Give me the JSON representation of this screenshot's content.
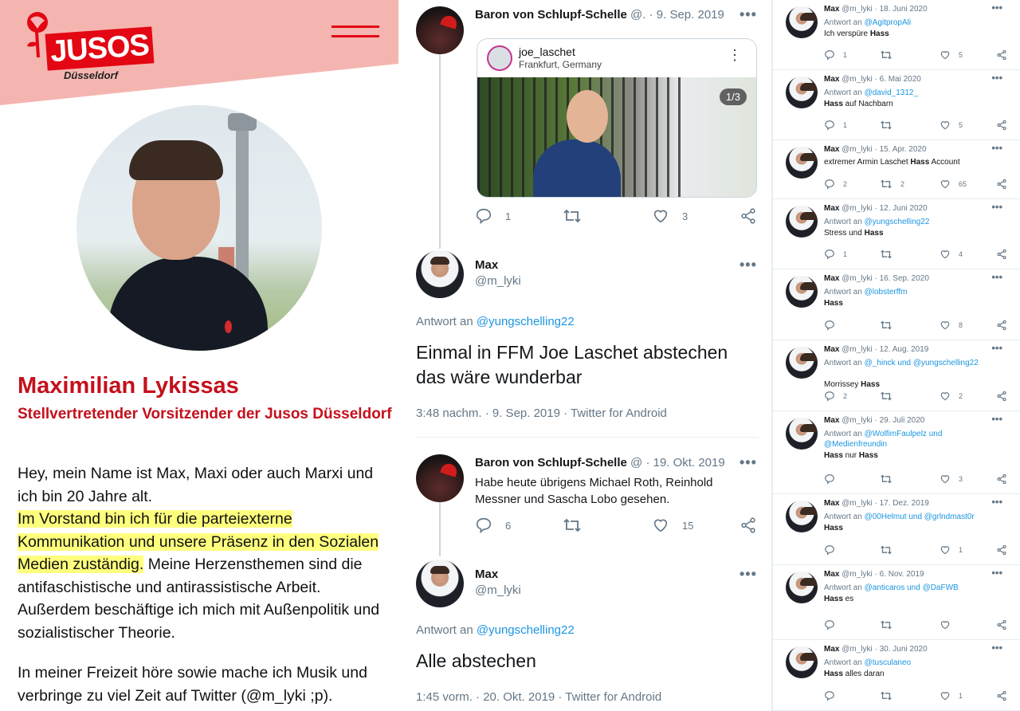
{
  "left_panel": {
    "logo_text": "JUSOS",
    "logo_city": "Düsseldorf",
    "name": "Maximilian Lykissas",
    "role": "Stellvertretender Vorsitzender der Jusos Düsseldorf",
    "bio_intro": "Hey, mein Name ist Max, Maxi oder auch Marxi und ich bin 20 Jahre alt.",
    "bio_highlight": "Im Vorstand bin ich für die parteiexterne Kommunikation und unsere Präsenz in den Sozialen Medien zuständig.",
    "bio_rest": " Meine Herzensthemen sind die antifaschistische und antirassistische Arbeit. Außerdem beschäftige ich mich mit Außenpolitik und sozialistischer Theorie.",
    "bio_free_time": "In meiner Freizeit höre sowie mache ich Musik und verbringe zu viel Zeit auf Twitter (@m_lyki ;p)."
  },
  "middle_panel": {
    "tweet1": {
      "name": "Baron von Schlupf-Schelle",
      "handle_date": "@. · 9. Sep. 2019",
      "instagram": {
        "user": "joe_laschet",
        "location": "Frankfurt, Germany",
        "counter": "1/3"
      },
      "replies": "1",
      "likes": "3"
    },
    "tweet2": {
      "name": "Max",
      "handle": "@m_lyki",
      "reply_prefix": "Antwort an",
      "reply_to": "@yungschelling22",
      "text": "Einmal in FFM Joe Laschet abstechen das wäre wunderbar",
      "timestamp": "3:48 nachm. · 9. Sep. 2019 · Twitter for Android"
    },
    "tweet3": {
      "name": "Baron von Schlupf-Schelle",
      "handle_date": "@ · 19. Okt. 2019",
      "text": "Habe heute übrigens Michael Roth, Reinhold Messner und Sascha Lobo gesehen.",
      "replies": "6",
      "likes": "15"
    },
    "tweet4": {
      "name": "Max",
      "handle": "@m_lyki",
      "reply_prefix": "Antwort an",
      "reply_to": "@yungschelling22",
      "text": "Alle abstechen",
      "timestamp": "1:45 vorm. · 20. Okt. 2019 · Twitter for Android"
    }
  },
  "right_panel": {
    "tweets": [
      {
        "name": "Max",
        "meta": "@m_lyki · 18. Juni 2020",
        "reply_prefix": "Antwort an",
        "reply_to": "@AgitpropAli",
        "text_plain": "Ich verspüre ",
        "text_bold": "Hass",
        "text_after": "",
        "replies": "1",
        "likes": "5"
      },
      {
        "name": "Max",
        "meta": "@m_lyki · 6. Mai 2020",
        "reply_prefix": "Antwort an",
        "reply_to": "@david_1312_",
        "text_plain": "",
        "text_bold": "Hass",
        "text_after": " auf Nachbarn",
        "replies": "1",
        "likes": "5"
      },
      {
        "name": "Max",
        "meta": "@m_lyki · 15. Apr. 2020",
        "reply_prefix": "",
        "reply_to": "",
        "text_plain": "extremer Armin Laschet ",
        "text_bold": "Hass",
        "text_after": " Account",
        "replies": "2",
        "retweets": "2",
        "likes": "65"
      },
      {
        "name": "Max",
        "meta": "@m_lyki · 12. Juni 2020",
        "reply_prefix": "Antwort an",
        "reply_to": "@yungschelling22",
        "text_plain": "Stress und ",
        "text_bold": "Hass",
        "text_after": "",
        "replies": "1",
        "likes": "4"
      },
      {
        "name": "Max",
        "meta": "@m_lyki · 16. Sep. 2020",
        "reply_prefix": "Antwort an",
        "reply_to": "@lobsterffm",
        "text_plain": "",
        "text_bold": "Hass",
        "text_after": "",
        "replies": "",
        "likes": "8"
      },
      {
        "name": "Max",
        "meta": "@m_lyki · 12. Aug. 2019",
        "reply_prefix": "Antwort an",
        "reply_to": "@_hinck und @yungschelling22",
        "text_plain": "Morrissey ",
        "text_bold": "Hass",
        "text_after": "",
        "replies": "2",
        "likes": "2"
      },
      {
        "name": "Max",
        "meta": "@m_lyki · 29. Juli 2020",
        "reply_prefix": "Antwort an",
        "reply_to": "@WolfimFaulpelz und @Medienfreundin",
        "text_plain": "",
        "text_bold": "Hass",
        "text_after": " nur ",
        "text_bold2": "Hass",
        "replies": "",
        "likes": "3"
      },
      {
        "name": "Max",
        "meta": "@m_lyki · 17. Dez. 2019",
        "reply_prefix": "Antwort an",
        "reply_to": "@00Helmut und @grlndmast0r",
        "text_plain": "",
        "text_bold": "Hass",
        "text_after": "",
        "replies": "",
        "likes": "1"
      },
      {
        "name": "Max",
        "meta": "@m_lyki · 6. Nov. 2019",
        "reply_prefix": "Antwort an",
        "reply_to": "@anticaros und @DaFWB",
        "text_plain": "",
        "text_bold": "Hass",
        "text_after": " es",
        "replies": "",
        "likes": ""
      },
      {
        "name": "Max",
        "meta": "@m_lyki · 30. Juni 2020",
        "reply_prefix": "Antwort an",
        "reply_to": "@tusculaneo",
        "text_plain": "",
        "text_bold": "Hass",
        "text_after": " alles daran",
        "replies": "",
        "likes": "1"
      }
    ]
  },
  "icons": {
    "reply": "reply-icon",
    "retweet": "retweet-icon",
    "like": "heart-icon",
    "share": "share-icon",
    "more": "more-icon",
    "menu": "hamburger-icon"
  },
  "colors": {
    "jusos_red": "#c4101c",
    "band_pink": "#f4b5b0",
    "highlight": "#ffff7e",
    "twitter_blue": "#1b95e0",
    "muted": "#657786"
  }
}
